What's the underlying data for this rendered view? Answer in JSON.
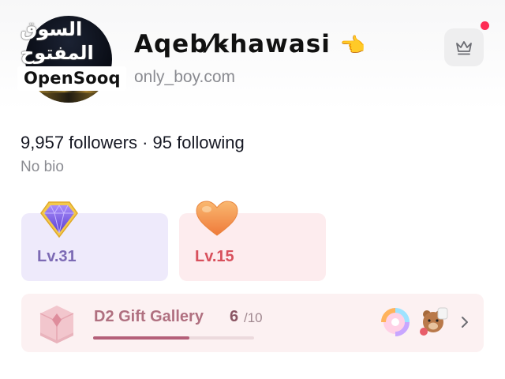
{
  "watermark": {
    "arabic": "السوق المفتوح",
    "latin": "OpenSooq"
  },
  "profile": {
    "display_name": "Aqeb⁄k̵hawasi",
    "name_emoji": "👈",
    "username_partial": "only_boy.com",
    "followers": "9,957 followers",
    "separator": " · ",
    "following": "95 following",
    "bio": "No bio"
  },
  "levels": [
    {
      "label": "Lv.31",
      "badge": "diamond-icon",
      "color": "#7c6ab4"
    },
    {
      "label": "Lv.15",
      "badge": "heart-icon",
      "color": "#d8505c"
    }
  ],
  "gift_gallery": {
    "title": "D2 Gift Gallery",
    "count": "6",
    "total": "/10",
    "progress_fraction": 0.6,
    "gifts": [
      "donut-gift-icon",
      "bear-gift-icon"
    ]
  },
  "icons": {
    "top_right": "crown-icon",
    "chevron": "chevron-right-icon"
  },
  "colors": {
    "notification_dot": "#fe2c55",
    "gallery_fill": "#b45f79"
  }
}
